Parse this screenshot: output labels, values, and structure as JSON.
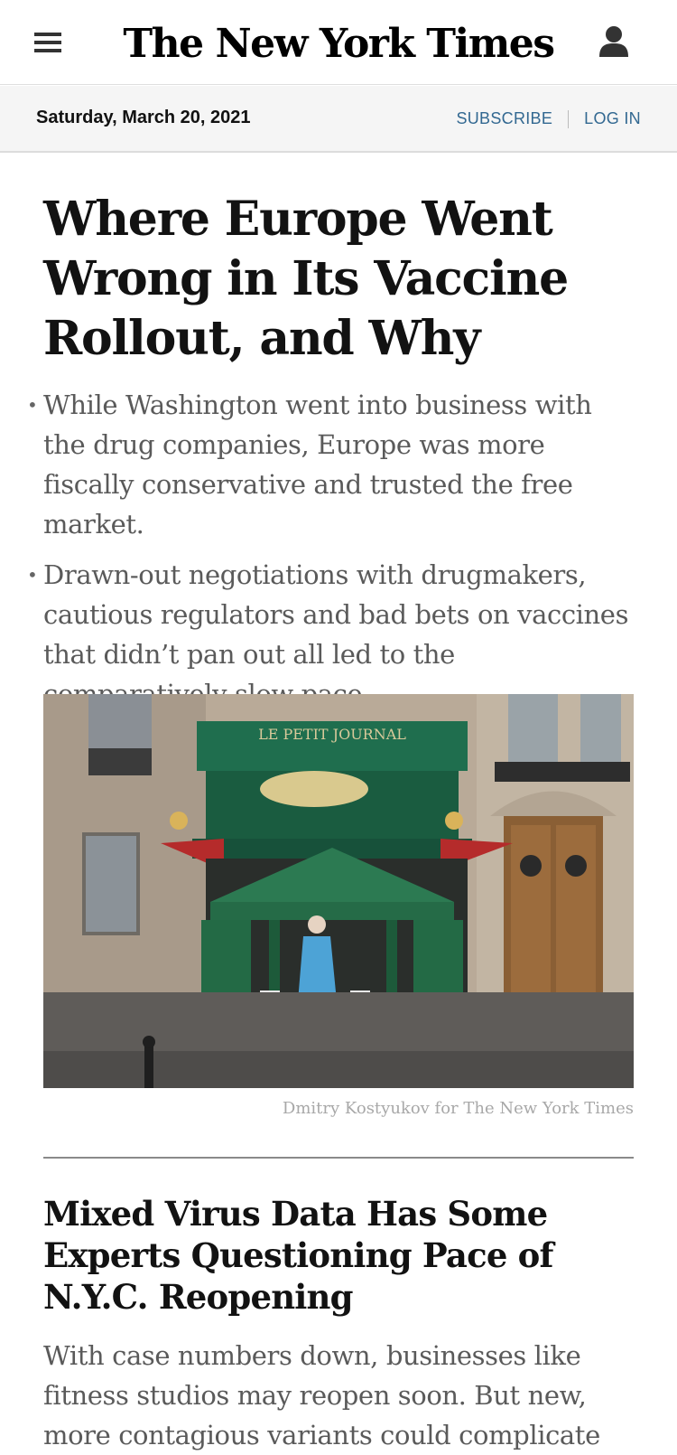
{
  "masthead": {
    "logo_text": "The New York Times",
    "menu_icon": "hamburger-menu-icon",
    "account_icon": "user-account-icon"
  },
  "datebar": {
    "date": "Saturday, March 20, 2021",
    "subscribe_label": "SUBSCRIBE",
    "login_label": "LOG IN"
  },
  "lead_story": {
    "headline": "Where Europe Went Wrong in Its Vaccine Rollout, and Why",
    "summary": [
      "While Washington went into business with the drug companies, Europe was more fiscally conservative and trusted the free market.",
      "Drawn-out negotiations with drugmakers, cautious regulators and bad bets on vaccines that didn’t pan out all led to the comparatively slow pace."
    ],
    "photo": {
      "kiosk_sign": "LE PETIT JOURNAL",
      "credit": "Dmitry Kostyukov for The New York Times"
    }
  },
  "second_story": {
    "headline": "Mixed Virus Data Has Some Experts Questioning Pace of N.Y.C. Reopening",
    "summary": "With case numbers down, businesses like fitness studios may reopen soon. But new, more contagious variants could complicate"
  },
  "colors": {
    "link_blue": "#326891",
    "summary_gray": "#5a5a5a",
    "kiosk_green": "#1f6e4e"
  }
}
